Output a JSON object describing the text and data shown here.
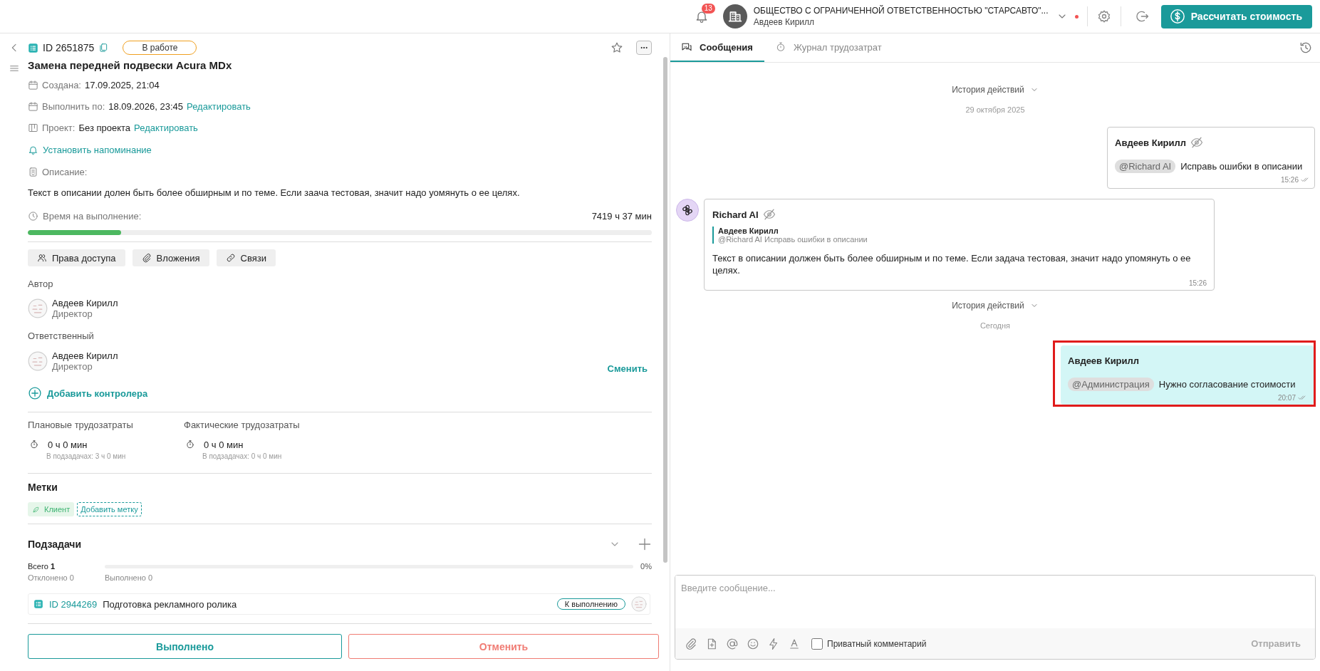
{
  "topbar": {
    "notifications": "13",
    "organization": "ОБЩЕСТВО С ОГРАНИЧЕННОЙ ОТВЕТСТВЕННОСТЬЮ \"СТАРСАВТО\"...",
    "user": "Авдеев Кирилл",
    "calculate_button": "Рассчитать стоимость"
  },
  "task": {
    "id": "ID 2651875",
    "status": "В работе",
    "title": "Замена передней подвески Acura MDx",
    "fields": [
      {
        "kind": "date",
        "label": "Создана:",
        "value": "17.09.2025, 21:04"
      },
      {
        "kind": "date",
        "label": "Выполнить по:",
        "value": "18.09.2026, 23:45",
        "action": "Редактировать"
      },
      {
        "kind": "project",
        "label": "Проект:",
        "value": "Без проекта",
        "action": "Редактировать"
      }
    ],
    "reminder": "Установить напоминание",
    "description_label": "Описание:",
    "description": "Текст в описании долен быть более обширным и по теме. Если заача тестовая, значит надо уомянуть о ее целях.",
    "time": {
      "label": "Время на выполнение:",
      "value": "7419 ч 37 мин",
      "level": 0.15
    },
    "actions": [
      {
        "kind": "access",
        "label": "Права доступа"
      },
      {
        "kind": "attachments",
        "label": "Вложения"
      },
      {
        "kind": "links",
        "label": "Связи"
      }
    ],
    "people": [
      {
        "role": "Автор",
        "name": "Авдеев Кирилл",
        "position": "Директор"
      },
      {
        "role": "Ответственный",
        "name": "Авдеев Кирилл",
        "position": "Директор",
        "action": "Сменить"
      }
    ],
    "add_controller": "Добавить контролера",
    "efforts": [
      {
        "label": "Плановые трудозатраты",
        "value": "0 ч 0 мин",
        "note": "В подзадачах: 3 ч 0 мин"
      },
      {
        "label": "Фактические трудозатраты",
        "value": "0 ч 0 мин",
        "note": "В подзадачах: 0 ч 0 мин"
      }
    ],
    "tags": {
      "title": "Метки",
      "items": [
        {
          "label": "Клиент",
          "color": "#3cb371"
        }
      ],
      "add": "Добавить метку"
    },
    "subtasks": {
      "title": "Подзадачи",
      "total_label": "Всего",
      "total": "1",
      "rejected": "Отклонено 0",
      "done": "Выполнено 0",
      "percent": "0%",
      "level": 0,
      "items": [
        {
          "id": "ID 2944269",
          "title": "Подготовка рекламного ролика",
          "status": "К выполнению"
        }
      ]
    },
    "buttons": {
      "complete": "Выполнено",
      "cancel": "Отменить"
    }
  },
  "chat": {
    "tabs": [
      {
        "kind": "messages",
        "label": "Сообщения",
        "selected": true
      },
      {
        "kind": "timelog",
        "label": "Журнал трудозатрат",
        "selected": false
      }
    ],
    "feed": [
      {
        "kind": "history",
        "label": "История действий"
      },
      {
        "kind": "date",
        "label": "29 октября 2025"
      },
      {
        "kind": "own",
        "author": "Авдеев Кирилл",
        "private": true,
        "mention": "@Richard AI",
        "text": "Исправь ошибки в описании",
        "time": "15:26",
        "highlighted": false
      },
      {
        "kind": "bot",
        "author": "Richard AI",
        "private": true,
        "quote": {
          "author": "Авдеев Кирилл",
          "text": "@Richard AI Исправь ошибки в описании"
        },
        "text": "Текст в описании должен быть более обширным и по теме. Если задача тестовая, значит надо упомянуть о ее целях.",
        "time": "15:26"
      },
      {
        "kind": "history",
        "label": "История действий"
      },
      {
        "kind": "date",
        "label": "Сегодня"
      },
      {
        "kind": "own",
        "author": "Авдеев Кирилл",
        "private": false,
        "mention": "@Администрация",
        "text": "Нужно согласование стоимости",
        "time": "20:07",
        "highlighted": true
      }
    ],
    "composer": {
      "placeholder": "Введите сообщение...",
      "private": {
        "label": "Приватный комментарий",
        "checked": false
      },
      "send": {
        "label": "Отправить",
        "disabled": true
      }
    }
  }
}
